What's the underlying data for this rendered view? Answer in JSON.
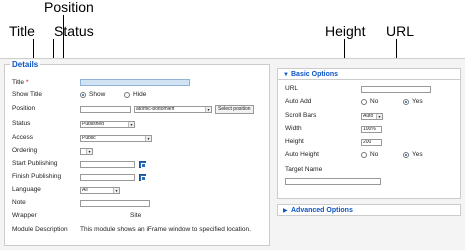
{
  "callouts": {
    "position": "Position",
    "title": "Title",
    "status": "Status",
    "height": "Height",
    "url": "URL"
  },
  "details": {
    "legend": "Details",
    "title_label": "Title",
    "required_mark": "*",
    "title_value": "",
    "show_title_label": "Show Title",
    "show_option": "Show",
    "hide_option": "Hide",
    "show_title_selected": "Show",
    "position_label": "Position",
    "position_value": "",
    "position_select": "atomic-bottomleft",
    "select_position_button": "Select position",
    "status_label": "Status",
    "status_value": "Published",
    "access_label": "Access",
    "access_value": "Public",
    "ordering_label": "Ordering",
    "ordering_value": "",
    "start_publishing_label": "Start Publishing",
    "finish_publishing_label": "Finish Publishing",
    "language_label": "Language",
    "language_value": "All",
    "note_label": "Note",
    "wrapper_label": "Wrapper",
    "wrapper_value": "Site",
    "module_description_label": "Module Description",
    "module_description_value": "This module shows an iFrame window to specified location."
  },
  "basic_options": {
    "header": "Basic Options",
    "caret": "▼",
    "url_label": "URL",
    "url_value": "",
    "auto_add_label": "Auto Add",
    "no_option": "No",
    "yes_option": "Yes",
    "scroll_bars_label": "Scroll Bars",
    "scroll_bars_value": "Auto",
    "width_label": "Width",
    "width_value": "100%",
    "height_label": "Height",
    "height_value": "200",
    "auto_height_label": "Auto Height",
    "target_name_label": "Target Name",
    "target_name_value": ""
  },
  "advanced_options": {
    "header": "Advanced Options",
    "caret": "▶"
  },
  "icons": {
    "dropdown": "▾",
    "calendar": "calendar-icon"
  }
}
